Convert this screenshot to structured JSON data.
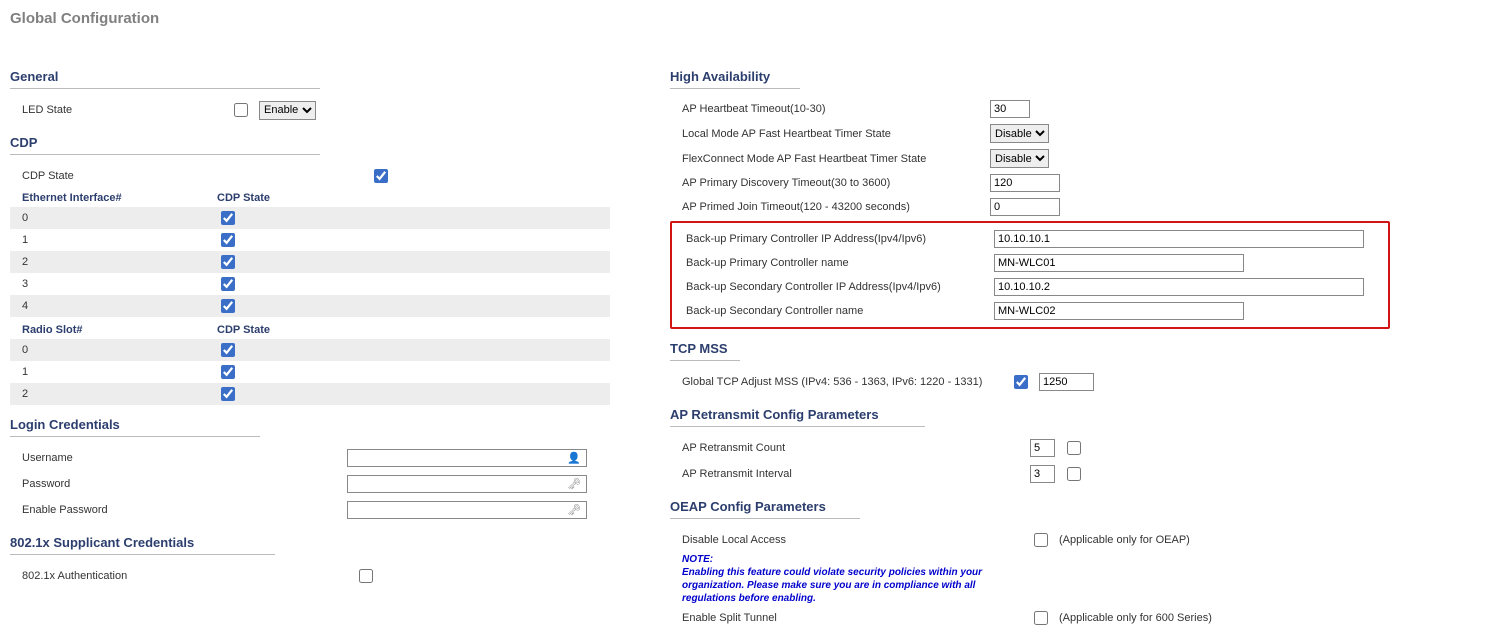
{
  "pageTitle": "Global Configuration",
  "left": {
    "general": {
      "header": "General",
      "ledStateLabel": "LED State",
      "ledEnable": "Enable"
    },
    "cdp": {
      "header": "CDP",
      "stateLabel": "CDP State",
      "ethHeader1": "Ethernet Interface#",
      "ethHeader2": "CDP State",
      "ethRows": [
        "0",
        "1",
        "2",
        "3",
        "4"
      ],
      "radioHeader1": "Radio Slot#",
      "radioHeader2": "CDP State",
      "radioRows": [
        "0",
        "1",
        "2"
      ]
    },
    "login": {
      "header": "Login Credentials",
      "userLabel": "Username",
      "passLabel": "Password",
      "enablePassLabel": "Enable Password"
    },
    "supplicant": {
      "header": "802.1x Supplicant Credentials",
      "authLabel": "802.1x Authentication"
    }
  },
  "right": {
    "ha": {
      "header": "High Availability",
      "hbTimeoutLabel": "AP Heartbeat Timeout(10-30)",
      "hbTimeoutVal": "30",
      "localFastLabel": "Local Mode AP Fast Heartbeat Timer State",
      "flexFastLabel": "FlexConnect Mode AP Fast Heartbeat Timer State",
      "disable": "Disable",
      "primaryDiscLabel": "AP Primary Discovery Timeout(30 to 3600)",
      "primaryDiscVal": "120",
      "primedJoinLabel": "AP Primed Join Timeout(120 - 43200 seconds)",
      "primedJoinVal": "0",
      "backupPriIpLabel": "Back-up Primary Controller IP Address(Ipv4/Ipv6)",
      "backupPriIpVal": "10.10.10.1",
      "backupPriNameLabel": "Back-up Primary Controller name",
      "backupPriNameVal": "MN-WLC01",
      "backupSecIpLabel": "Back-up Secondary Controller IP Address(Ipv4/Ipv6)",
      "backupSecIpVal": "10.10.10.2",
      "backupSecNameLabel": "Back-up Secondary Controller name",
      "backupSecNameVal": "MN-WLC02"
    },
    "tcp": {
      "header": "TCP MSS",
      "mssLabel": "Global TCP Adjust MSS (IPv4: 536 - 1363, IPv6: 1220 - 1331)",
      "mssVal": "1250"
    },
    "apretrans": {
      "header": "AP Retransmit Config Parameters",
      "countLabel": "AP Retransmit Count",
      "countVal": "5",
      "intervalLabel": "AP Retransmit Interval",
      "intervalVal": "3"
    },
    "oeap": {
      "header": "OEAP Config Parameters",
      "disableLocalLabel": "Disable Local Access",
      "oeapParen": "(Applicable only for OEAP)",
      "noteTitle": "NOTE:",
      "noteBody": "Enabling this feature could violate security policies within your organization. Please make sure you are in compliance with all regulations before enabling.",
      "splitLabel": "Enable Split Tunnel",
      "splitParen": "(Applicable only for 600 Series)"
    }
  }
}
